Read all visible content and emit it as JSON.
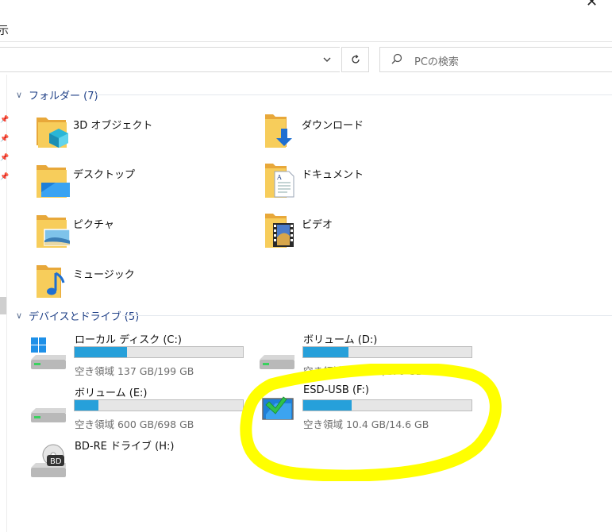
{
  "ribbon": {
    "label": "示"
  },
  "search": {
    "placeholder": "PCの検索"
  },
  "sections": {
    "folders": {
      "label": "フォルダー (7)"
    },
    "devices": {
      "label": "デバイスとドライブ (5)"
    }
  },
  "folders": [
    {
      "label": "3D オブジェクト",
      "icon": "3d-objects-icon"
    },
    {
      "label": "ダウンロード",
      "icon": "downloads-icon"
    },
    {
      "label": "デスクトップ",
      "icon": "desktop-icon"
    },
    {
      "label": "ドキュメント",
      "icon": "documents-icon"
    },
    {
      "label": "ピクチャ",
      "icon": "pictures-icon"
    },
    {
      "label": "ビデオ",
      "icon": "videos-icon"
    },
    {
      "label": "ミュージック",
      "icon": "music-icon"
    }
  ],
  "drives": [
    {
      "name": "ローカル ディスク (C:)",
      "space": "空き領域 137 GB/199 GB",
      "used_fraction": 0.31
    },
    {
      "name": "ボリューム (D:)",
      "space": "空き領域 200 GB/276 GB",
      "used_fraction": 0.27
    },
    {
      "name": "ボリューム (E:)",
      "space": "空き領域 600 GB/698 GB",
      "used_fraction": 0.14
    },
    {
      "name": "ESD-USB (F:)",
      "space": "空き領域 10.4 GB/14.6 GB",
      "used_fraction": 0.29
    },
    {
      "name": "BD-RE ドライブ (H:)"
    }
  ],
  "colors": {
    "accent": "#26a0da",
    "header": "#1e3f86",
    "highlight": "#ffff00",
    "folder": "#f5c242"
  }
}
